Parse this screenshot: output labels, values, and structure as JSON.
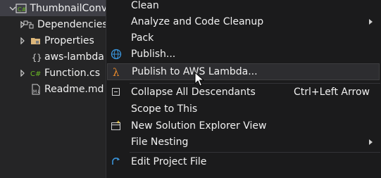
{
  "tree": {
    "items": [
      {
        "label": "ThumbnailConv",
        "icon": "csharp-project-icon",
        "expandable": true
      },
      {
        "label": "Dependencies",
        "icon": "dependencies-icon",
        "expandable": true
      },
      {
        "label": "Properties",
        "icon": "properties-folder-icon",
        "expandable": true
      },
      {
        "label": "aws-lambda",
        "icon": "json-file-icon",
        "expandable": false
      },
      {
        "label": "Function.cs",
        "icon": "csharp-file-icon",
        "expandable": true
      },
      {
        "label": "Readme.md",
        "icon": "markdown-file-icon",
        "expandable": false
      }
    ]
  },
  "menu": {
    "items": [
      {
        "label": "Clean",
        "shortcut": "",
        "icon": "",
        "submenu": false
      },
      {
        "label": "Analyze and Code Cleanup",
        "shortcut": "",
        "icon": "",
        "submenu": true
      },
      {
        "label": "Pack",
        "shortcut": "",
        "icon": "",
        "submenu": false
      },
      {
        "label": "Publish...",
        "shortcut": "",
        "icon": "globe-icon",
        "submenu": false
      },
      {
        "label": "Publish to AWS Lambda...",
        "shortcut": "",
        "icon": "lambda-icon",
        "submenu": false,
        "highlighted": true
      },
      {
        "label": "Collapse All Descendants",
        "shortcut": "Ctrl+Left Arrow",
        "icon": "collapse-icon",
        "submenu": false
      },
      {
        "label": "Scope to This",
        "shortcut": "",
        "icon": "",
        "submenu": false
      },
      {
        "label": "New Solution Explorer View",
        "shortcut": "",
        "icon": "new-view-icon",
        "submenu": false
      },
      {
        "label": "File Nesting",
        "shortcut": "",
        "icon": "",
        "submenu": true
      },
      {
        "label": "Edit Project File",
        "shortcut": "",
        "icon": "edit-project-icon",
        "submenu": false
      }
    ]
  },
  "colors": {
    "menu_bg": "#1b1b1c",
    "tree_bg": "#252526",
    "highlight_bg": "#2d2d30",
    "text": "#f1f1f1",
    "lambda_orange": "#e8892b",
    "csharp_green": "#68b723",
    "globe_blue": "#3a96dd"
  }
}
